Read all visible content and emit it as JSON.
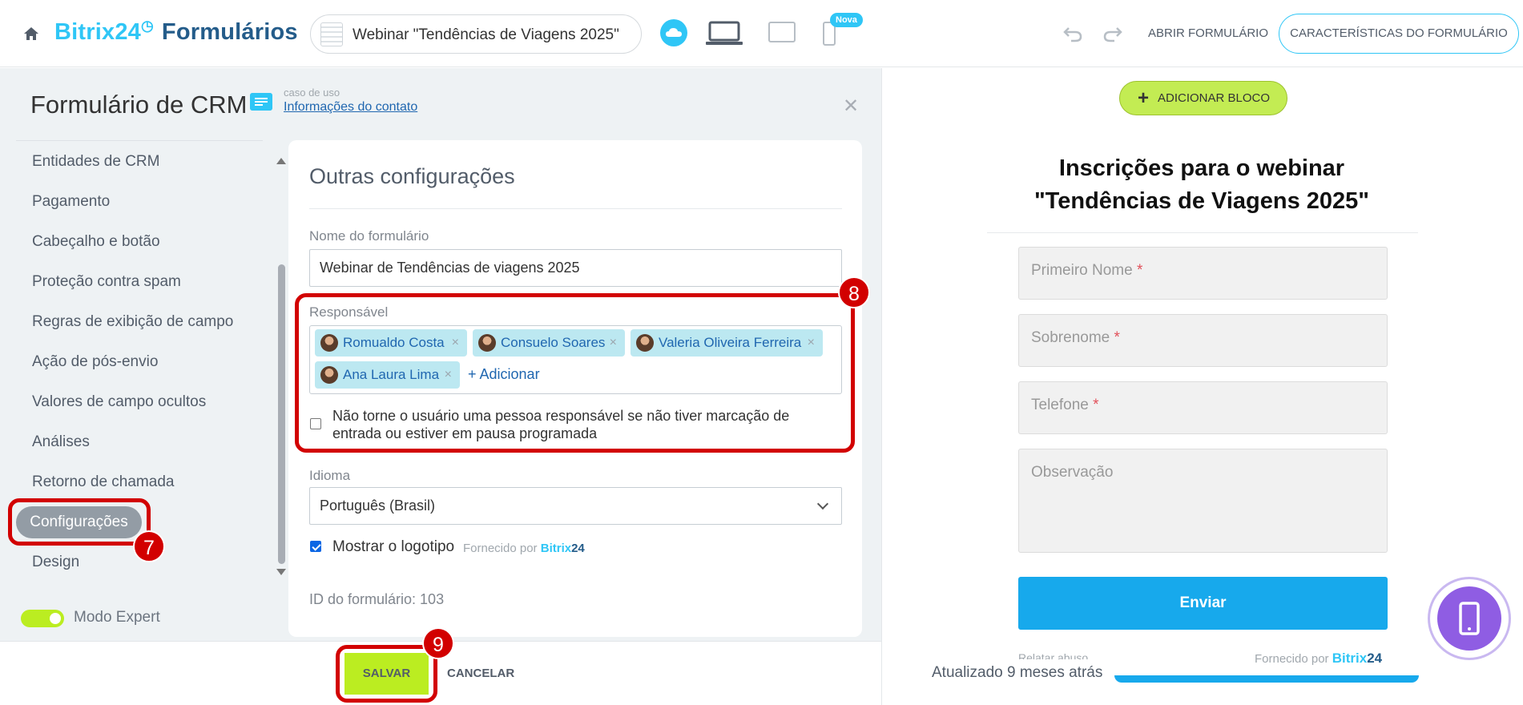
{
  "header": {
    "logo_brand": "Bitrix24",
    "logo_clock": "◷",
    "logo_product": "Formulários",
    "form_name": "Webinar \"Tendências de Viagens 2025\"",
    "nova_badge": "Nova",
    "open_form": "ABRIR FORMULÁRIO",
    "form_characteristics": "CARACTERÍSTICAS DO FORMULÁRIO"
  },
  "left": {
    "title": "Formulário de CRM",
    "use_case_label": "caso de uso",
    "use_case_link": "Informações do contato",
    "nav": [
      "Entidades de CRM",
      "Pagamento",
      "Cabeçalho e botão",
      "Proteção contra spam",
      "Regras de exibição de campo",
      "Ação de pós-envio",
      "Valores de campo ocultos",
      "Análises",
      "Retorno de chamada",
      "Configurações",
      "Design"
    ],
    "active_nav": "Configurações",
    "expert_mode_label": "Modo Expert",
    "expert_mode_on": true
  },
  "settings": {
    "title": "Outras configurações",
    "form_name_label": "Nome do formulário",
    "form_name_value": "Webinar de Tendências de viagens 2025",
    "responsible_label": "Responsável",
    "responsible": [
      "Romualdo Costa",
      "Consuelo Soares",
      "Valeria Oliveira Ferreira",
      "Ana Laura Lima"
    ],
    "tag_remove": "×",
    "add_link": "+ Adicionar",
    "no_checkin_text": "Não torne o usuário uma pessoa responsável se não tiver marcação de entrada ou estiver em pausa programada",
    "no_checkin_checked": false,
    "language_label": "Idioma",
    "language_value": "Português (Brasil)",
    "show_logo_label": "Mostrar o logotipo",
    "show_logo_checked": true,
    "powered_by": "Fornecido por",
    "powered_brand": "Bitrix",
    "powered_brand_num": "24",
    "form_id": "ID do formulário: 103"
  },
  "annotations": {
    "a7": "7",
    "a8": "8",
    "a9": "9"
  },
  "footer": {
    "save": "SALVAR",
    "cancel": "CANCELAR"
  },
  "preview": {
    "add_block": "ADICIONAR BLOCO",
    "title_line1": "Inscrições para o webinar",
    "title_line2": "\"Tendências de Viagens 2025\"",
    "fields": [
      "Primeiro Nome",
      "Sobrenome",
      "Telefone",
      "Observação"
    ],
    "required_mark": "*",
    "submit": "Enviar",
    "report_abuse": "Relatar abuso",
    "powered_by": "Fornecido por",
    "powered_brand": "Bitrix",
    "powered_brand_num": "24",
    "updated": "Atualizado 9 meses atrás"
  },
  "colors": {
    "accent": "#2fc6f6",
    "save_green": "#bbed21",
    "annotation_red": "#d20000",
    "submit_blue": "#17a9ec",
    "mobile_purple": "#8f5de3"
  }
}
